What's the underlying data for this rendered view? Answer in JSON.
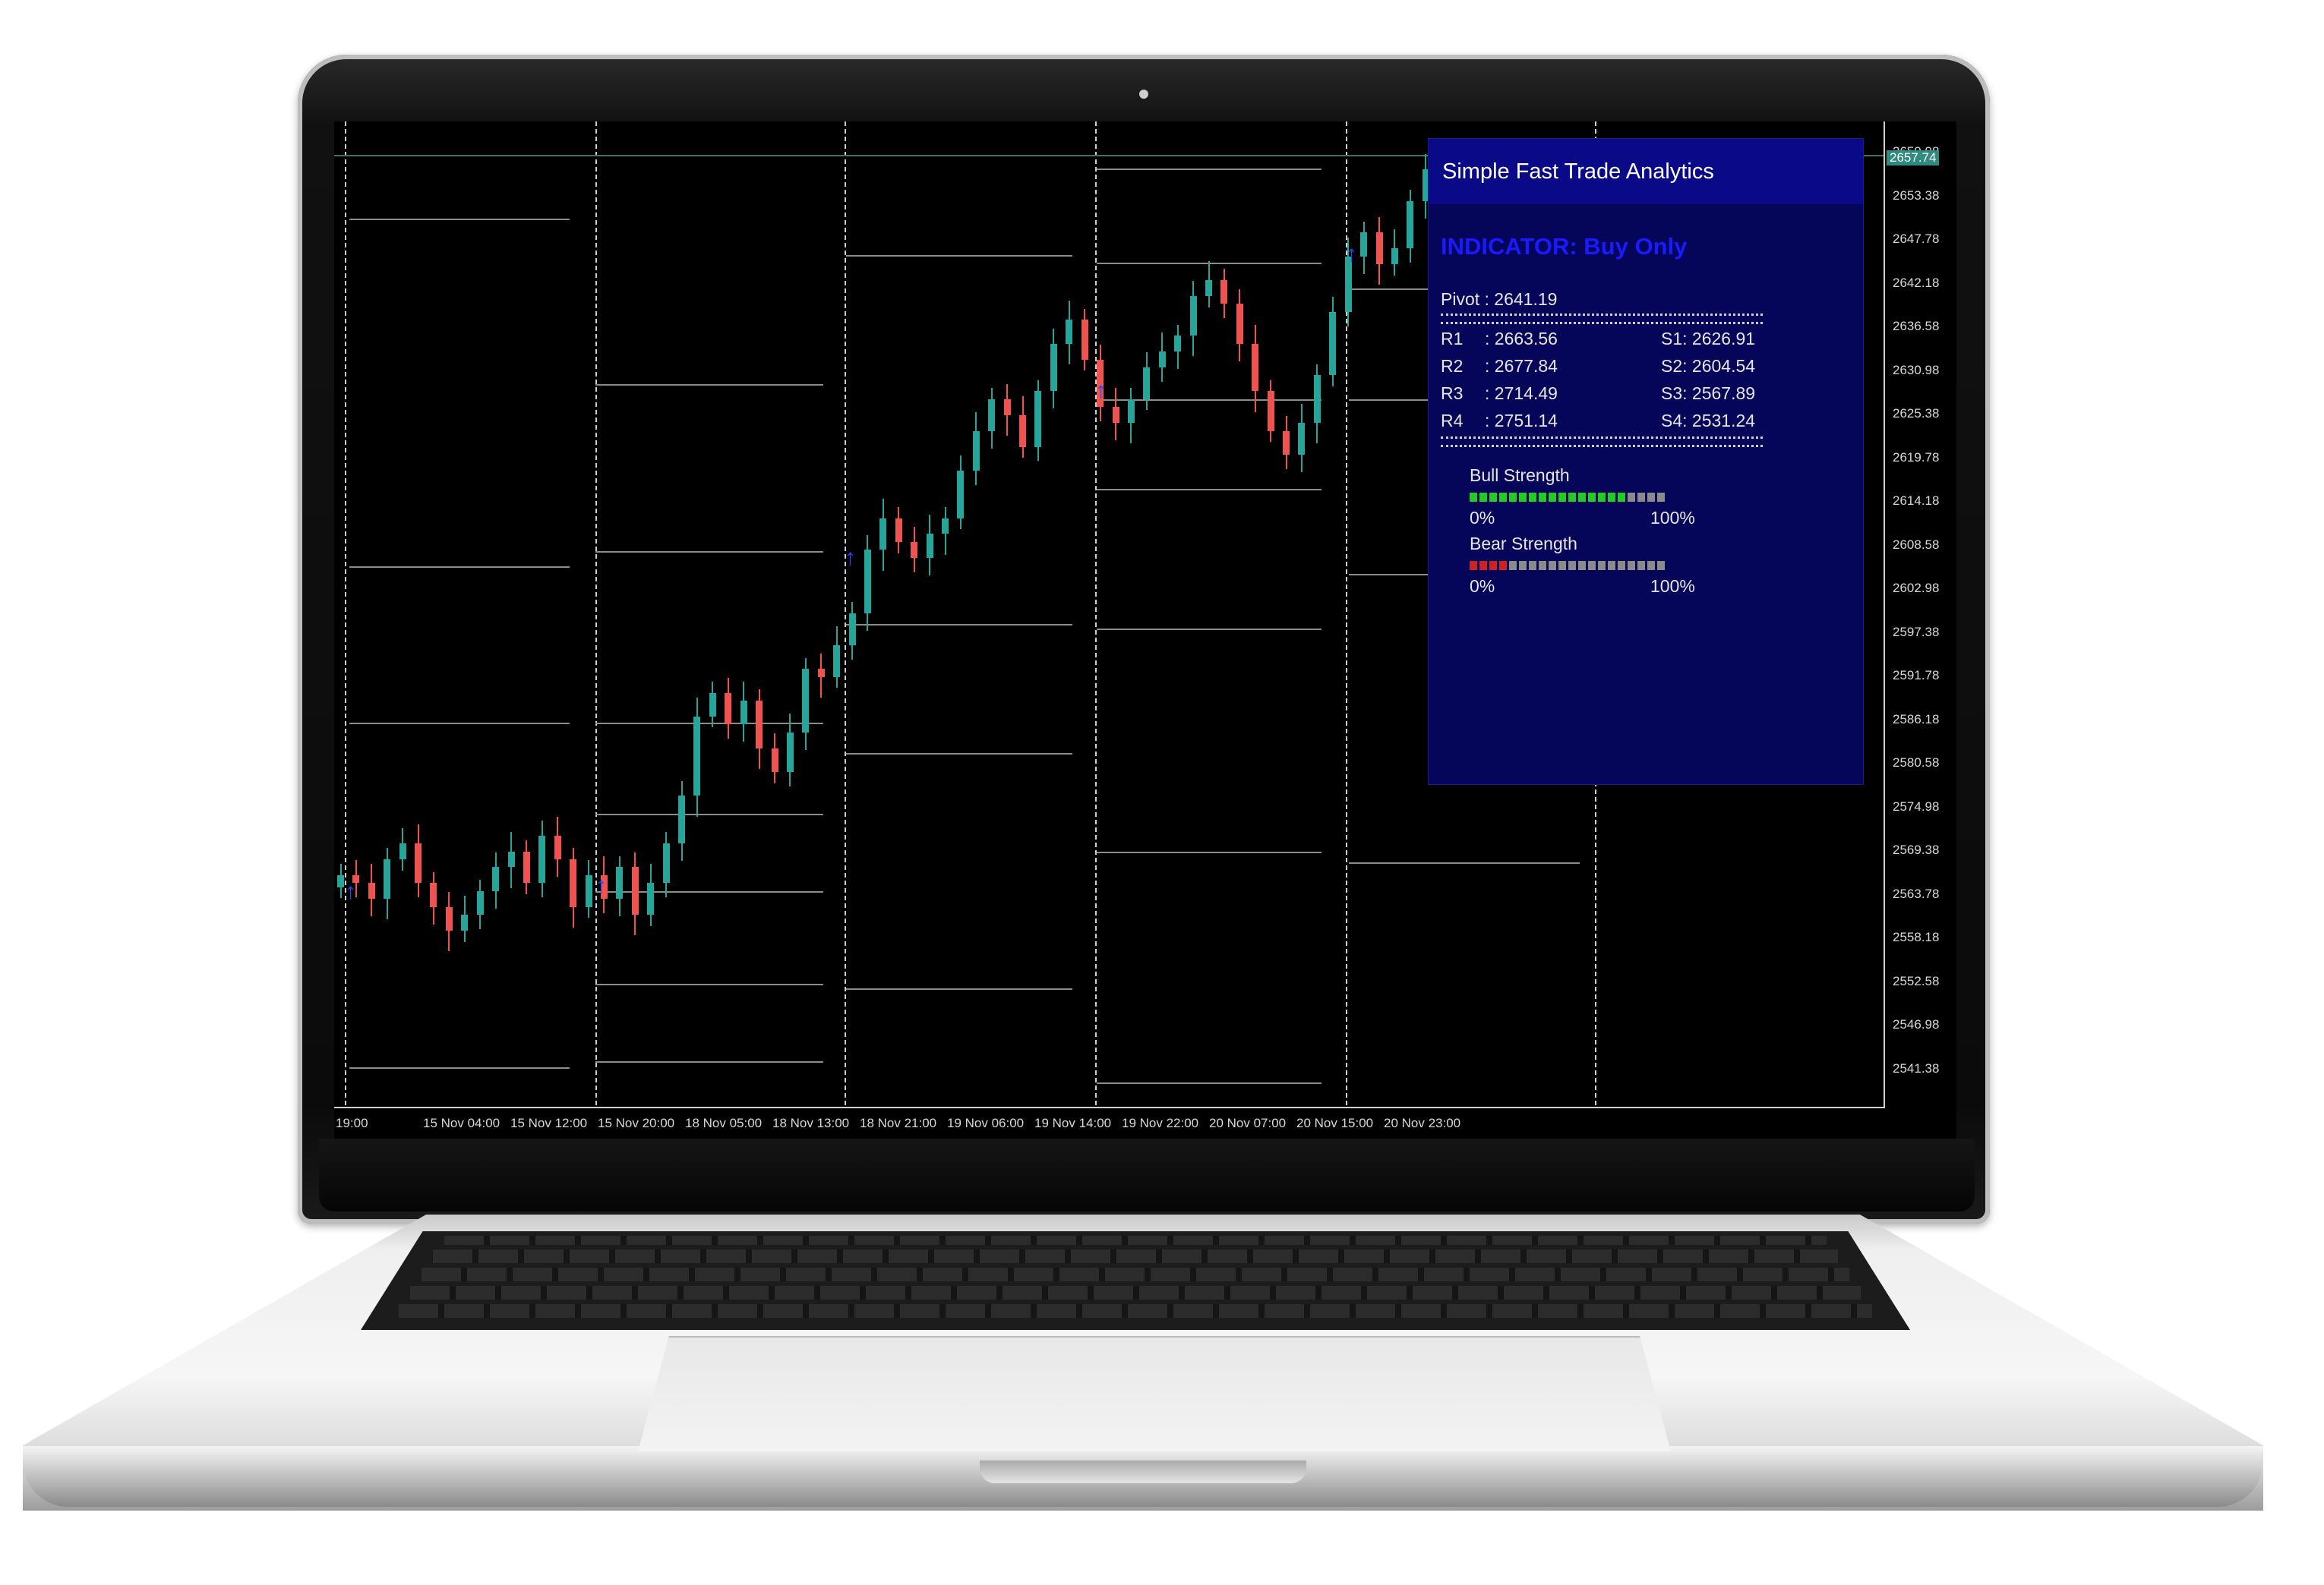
{
  "panel": {
    "title": "Simple Fast Trade Analytics",
    "indicator": "INDICATOR: Buy Only",
    "pivot": "Pivot : 2641.19",
    "levels": [
      {
        "r_label": "R1",
        "r_value": ": 2663.56",
        "s": "S1: 2626.91"
      },
      {
        "r_label": "R2",
        "r_value": ": 2677.84",
        "s": "S2: 2604.54"
      },
      {
        "r_label": "R3",
        "r_value": ": 2714.49",
        "s": "S3: 2567.89"
      },
      {
        "r_label": "R4",
        "r_value": ": 2751.14",
        "s": "S4: 2531.24"
      }
    ],
    "bull_label": "Bull Strength",
    "bear_label": "Bear Strength",
    "min_label": "0%",
    "max_label": "100%",
    "bull_fraction": 0.78,
    "bear_fraction": 0.18,
    "bull_color": "#22cc22",
    "bear_color": "#cc2222",
    "empty_color": "#8a8a8a"
  },
  "price_axis": {
    "ticks": [
      "2659.98",
      "2653.38",
      "2647.78",
      "2642.18",
      "2636.58",
      "2630.98",
      "2625.38",
      "2619.78",
      "2614.18",
      "2608.58",
      "2602.98",
      "2597.38",
      "2591.78",
      "2586.18",
      "2580.58",
      "2574.98",
      "2569.38",
      "2563.78",
      "2558.18",
      "2552.58",
      "2546.98",
      "2541.38"
    ],
    "current": "2657.74"
  },
  "time_axis": {
    "ticks": [
      "19:00",
      "15 Nov 04:00",
      "15 Nov 12:00",
      "15 Nov 20:00",
      "18 Nov 05:00",
      "18 Nov 13:00",
      "18 Nov 21:00",
      "19 Nov 06:00",
      "19 Nov 14:00",
      "19 Nov 22:00",
      "20 Nov 07:00",
      "20 Nov 15:00",
      "20 Nov 23:00"
    ]
  },
  "colors": {
    "bull_candle": "#26a69a",
    "bear_candle": "#ef5350",
    "signal_arrow": "#1e4bff",
    "level_line": "#bfbfbf"
  },
  "chart_data": {
    "type": "candlestick",
    "x_unit": "hourly bars",
    "y_range": [
      2538,
      2662
    ],
    "closes": [
      2567,
      2566,
      2564,
      2569,
      2571,
      2566,
      2563,
      2560,
      2562,
      2565,
      2568,
      2570,
      2566,
      2572,
      2569,
      2563,
      2567,
      2564,
      2568,
      2562,
      2566,
      2571,
      2577,
      2587,
      2590,
      2586,
      2589,
      2583,
      2580,
      2585,
      2593,
      2592,
      2596,
      2600,
      2608,
      2612,
      2609,
      2607,
      2610,
      2612,
      2618,
      2623,
      2627,
      2625,
      2621,
      2628,
      2634,
      2637,
      2632,
      2626,
      2624,
      2627,
      2631,
      2633,
      2635,
      2640,
      2642,
      2639,
      2634,
      2628,
      2623,
      2620,
      2624,
      2630,
      2638,
      2645,
      2648,
      2644,
      2646,
      2652,
      2656,
      2654,
      2657
    ]
  }
}
